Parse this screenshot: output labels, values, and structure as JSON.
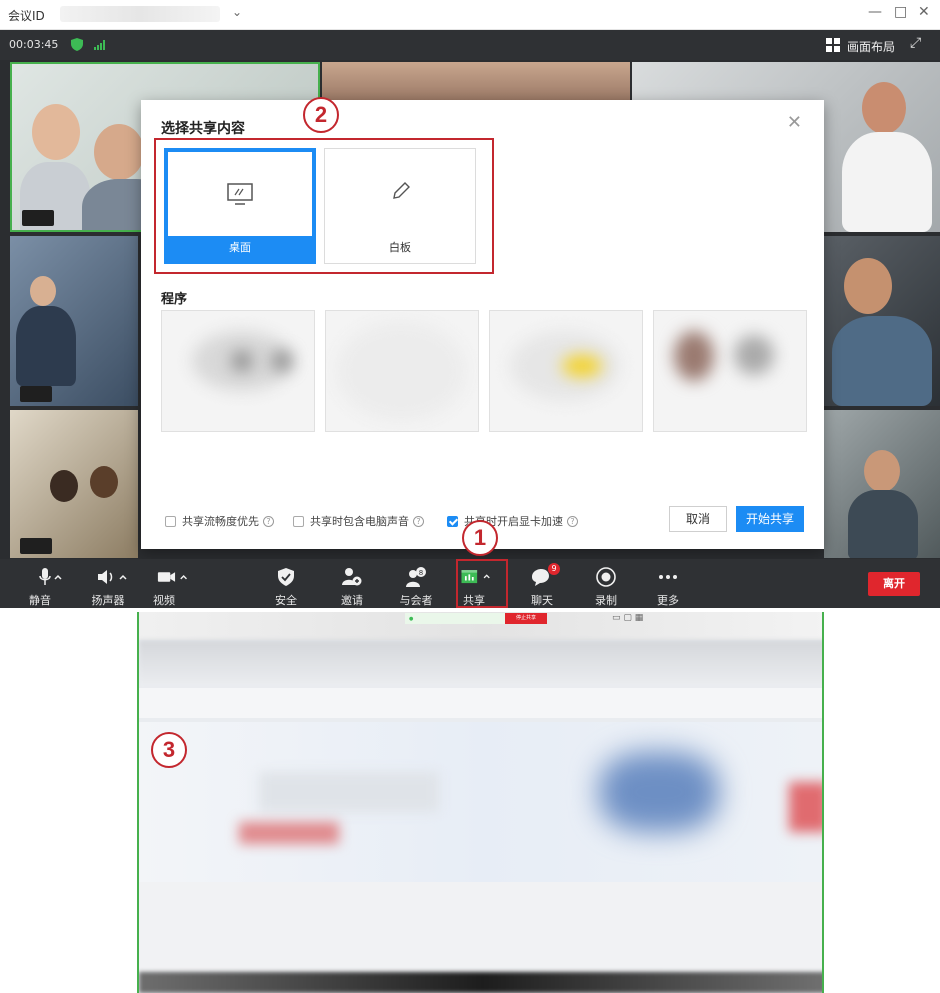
{
  "titlebar": {
    "meeting_id_label": "会议ID",
    "minimize": "—",
    "maximize": "□",
    "close": "✕"
  },
  "status": {
    "elapsed": "00:03:45",
    "layout_label": "画面布局"
  },
  "dialog": {
    "title": "选择共享内容",
    "options": [
      {
        "label": "桌面",
        "selected": true
      },
      {
        "label": "白板",
        "selected": false
      }
    ],
    "programs_title": "程序",
    "checkboxes": [
      {
        "label": "共享流畅度优先",
        "checked": false
      },
      {
        "label": "共享时包含电脑声音",
        "checked": false
      },
      {
        "label": "共享时开启显卡加速",
        "checked": true
      }
    ],
    "cancel": "取消",
    "start": "开始共享"
  },
  "toolbar": {
    "mute": "静音",
    "speaker": "扬声器",
    "video": "视频",
    "security": "安全",
    "invite": "邀请",
    "participants": "与会者",
    "share": "共享",
    "chat": "聊天",
    "record": "录制",
    "more": "更多",
    "leave": "离开",
    "chat_badge": "9"
  },
  "markers": {
    "one": "1",
    "two": "2",
    "three": "3"
  },
  "shared_preview": {
    "stop_share": "停止共享"
  },
  "colors": {
    "accent": "#1c8cf4",
    "marker_red": "#c3272e",
    "leave_red": "#e0262d",
    "share_green": "#3dbb55"
  }
}
